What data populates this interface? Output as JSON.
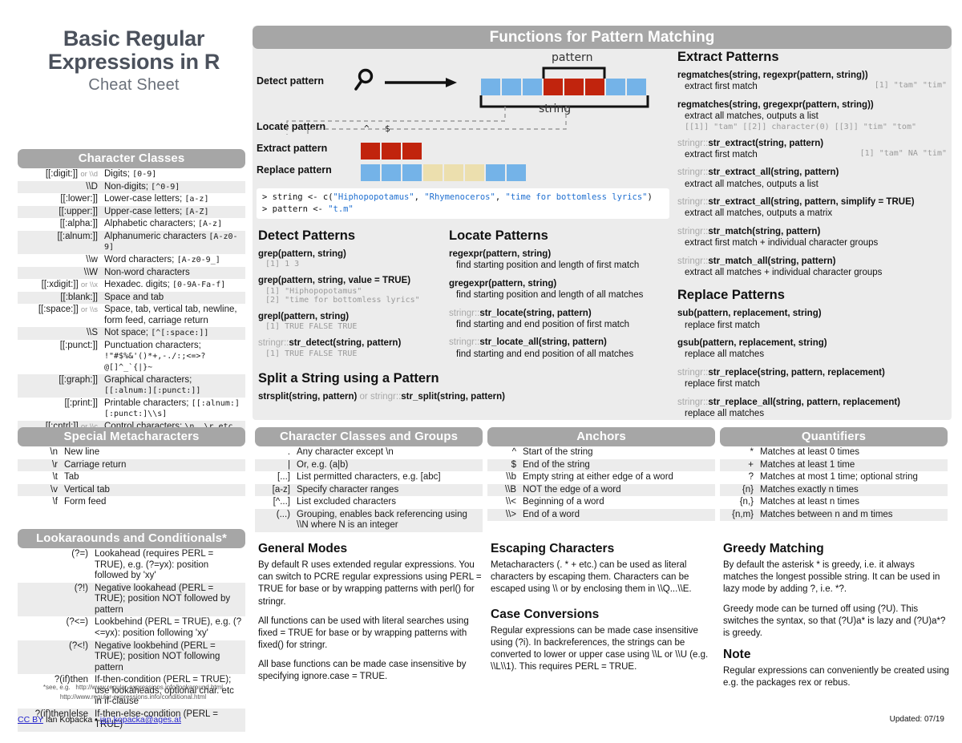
{
  "title": {
    "line1": "Basic Regular",
    "line2": "Expressions in R",
    "subtitle": "Cheat Sheet"
  },
  "main": {
    "header": "Functions for Pattern Matching"
  },
  "diagram": {
    "labels": {
      "detect": "Detect pattern",
      "locate": "Locate pattern",
      "extract": "Extract pattern",
      "replace": "Replace pattern"
    },
    "annotations": {
      "pattern": "pattern",
      "string": "string"
    },
    "locate_marks": {
      "start": "^",
      "end": "$"
    },
    "colors": {
      "blue": "#74b3e8",
      "red": "#c1240d",
      "tan": "#ecdfae"
    }
  },
  "console": {
    "line1_prompt": "> ",
    "line1_a": "string <- c(",
    "line1_s1": "\"Hiphopopotamus\"",
    "line1_c1": ", ",
    "line1_s2": "\"Rhymenoceros\"",
    "line1_c2": ", ",
    "line1_s3": "\"time for bottomless lyrics\"",
    "line1_end": ")",
    "line2_prompt": "> ",
    "line2_a": "pattern <- ",
    "line2_s1": "\"t.m\""
  },
  "character_classes": {
    "header": "Character Classes",
    "rows": [
      {
        "key": "[[:digit:]]",
        "key_alt": "or \\\\d",
        "desc": "Digits;",
        "code": "[0-9]"
      },
      {
        "key": "\\\\D",
        "key_alt": "",
        "desc": "Non-digits;",
        "code": "[^0-9]"
      },
      {
        "key": "[[:lower:]]",
        "key_alt": "",
        "desc": "Lower-case letters;",
        "code": "[a-z]"
      },
      {
        "key": "[[:upper:]]",
        "key_alt": "",
        "desc": "Upper-case letters;",
        "code": "[A-Z]"
      },
      {
        "key": "[[:alpha:]]",
        "key_alt": "",
        "desc": "Alphabetic characters;",
        "code": "[A-z]"
      },
      {
        "key": "[[:alnum:]]",
        "key_alt": "",
        "desc": "Alphanumeric characters",
        "code": "[A-z0-9]"
      },
      {
        "key": "\\\\w",
        "key_alt": "",
        "desc": "Word characters;",
        "code": "[A-z0-9_]"
      },
      {
        "key": "\\\\W",
        "key_alt": "",
        "desc": "Non-word characters",
        "code": ""
      },
      {
        "key": "[[:xdigit:]]",
        "key_alt": "or \\\\x",
        "desc": "Hexadec. digits;",
        "code": "[0-9A-Fa-f]"
      },
      {
        "key": "[[:blank:]]",
        "key_alt": "",
        "desc": "Space and tab",
        "code": ""
      },
      {
        "key": "[[:space:]]",
        "key_alt": "or \\\\s",
        "desc": "Space, tab, vertical tab, newline, form feed, carriage return",
        "code": ""
      },
      {
        "key": "\\\\S",
        "key_alt": "",
        "desc": "Not space;",
        "code": "[^[:space:]]"
      },
      {
        "key": "[[:punct:]]",
        "key_alt": "",
        "desc": "Punctuation characters;",
        "code": "!\"#$%&'()*+,-./:;<=>?@[]^_`{|}~"
      },
      {
        "key": "[[:graph:]]",
        "key_alt": "",
        "desc": "Graphical characters;",
        "code": "[[:alnum:][:punct:]]"
      },
      {
        "key": "[[:print:]]",
        "key_alt": "",
        "desc": "Printable characters;",
        "code": "[[:alnum:][:punct:]\\\\s]"
      },
      {
        "key": "[[:cntrl:]]",
        "key_alt": "or \\\\c",
        "desc": "Control characters;",
        "code": "\\n,  \\r etc."
      }
    ]
  },
  "special_metacharacters": {
    "header": "Special Metacharacters",
    "rows": [
      {
        "key": "\\n",
        "desc": "New line"
      },
      {
        "key": "\\r",
        "desc": "Carriage return"
      },
      {
        "key": "\\t",
        "desc": "Tab"
      },
      {
        "key": "\\v",
        "desc": "Vertical tab"
      },
      {
        "key": "\\f",
        "desc": "Form feed"
      }
    ]
  },
  "lookarounds": {
    "header": "Lookaraounds and Conditionals*",
    "rows": [
      {
        "key": "(?=)",
        "key_grey": "",
        "desc": "Lookahead (requires PERL = TRUE), e.g. (?=yx): position followed by 'xy'"
      },
      {
        "key": "(?!)",
        "key_grey": "",
        "desc": "Negative lookahead (PERL = TRUE); position NOT followed by pattern"
      },
      {
        "key": "(?<=)",
        "key_grey": "",
        "desc": "Lookbehind (PERL = TRUE), e.g. (?<=yx): position following 'xy'"
      },
      {
        "key": "(?<!)",
        "key_grey": "",
        "desc": "Negative lookbehind (PERL = TRUE); position NOT following pattern"
      },
      {
        "key": "?(if)then",
        "key_grey": "",
        "desc": "If-then-condition (PERL = TRUE); use lookaheads, optional char. etc in if-clause"
      },
      {
        "key": "?(if)then|else",
        "key_grey": "",
        "desc": "If-then-else-condition (PERL = TRUE)"
      }
    ],
    "footnote_label": "*see, e.g.",
    "footnote_url1": "http://www.regular-expressions.info/lookaround.html",
    "footnote_url2": "http://www.regular-expressions.info/conditional.html"
  },
  "detect_patterns": {
    "header": "Detect Patterns",
    "items": [
      {
        "sig": "grep(pattern, string)",
        "pkg": "",
        "desc": "",
        "out": "[1] 1 3"
      },
      {
        "sig": "grep(pattern, string, value = TRUE)",
        "pkg": "",
        "desc": "",
        "out": "[1] \"Hiphopopotamus\"\n[2] \"time for bottomless lyrics\""
      },
      {
        "sig": "grepl(pattern, string)",
        "pkg": "",
        "desc": "",
        "out": "[1]  TRUE FALSE  TRUE"
      },
      {
        "sig": "str_detect(string, pattern)",
        "pkg": "stringr::",
        "desc": "",
        "out": "[1]  TRUE FALSE  TRUE"
      }
    ]
  },
  "split_string": {
    "header": "Split a String using a Pattern",
    "sig_a": "strsplit(string, pattern)",
    "sig_or": " or ",
    "sig_pkg": "stringr::",
    "sig_b": "str_split(string, pattern)"
  },
  "locate_patterns": {
    "header": "Locate Patterns",
    "items": [
      {
        "pkg": "",
        "sig": "regexpr(pattern, string)",
        "desc": "find starting position and length of first match"
      },
      {
        "pkg": "",
        "sig": "gregexpr(pattern, string)",
        "desc": "find starting position and length of all matches"
      },
      {
        "pkg": "stringr::",
        "sig": "str_locate(string, pattern)",
        "desc": "find starting and end position of first match"
      },
      {
        "pkg": "stringr::",
        "sig": "str_locate_all(string, pattern)",
        "desc": "find starting and end position of all matches"
      }
    ]
  },
  "extract_patterns": {
    "header": "Extract Patterns",
    "items": [
      {
        "pkg": "",
        "sig": "regmatches(string, regexpr(pattern, string))",
        "desc": "extract first match",
        "out": "[1] \"tam\" \"tim\"",
        "inline": true
      },
      {
        "pkg": "",
        "sig": "regmatches(string, gregexpr(pattern, string))",
        "desc": "extract all matches, outputs a list",
        "out": "[[1]] \"tam\" [[2]] character(0) [[3]] \"tim\" \"tom\"",
        "inline": false
      },
      {
        "pkg": "stringr::",
        "sig": "str_extract(string, pattern)",
        "desc": "extract first match",
        "out": "[1] \"tam\" NA  \"tim\"",
        "inline": true
      },
      {
        "pkg": "stringr::",
        "sig": "str_extract_all(string, pattern)",
        "desc": "extract all matches, outputs a list",
        "out": "",
        "inline": false
      },
      {
        "pkg": "stringr::",
        "sig": "str_extract_all(string, pattern, simplify = TRUE)",
        "desc": "extract all matches, outputs a matrix",
        "out": "",
        "inline": false
      },
      {
        "pkg": "stringr::",
        "sig": "str_match(string, pattern)",
        "desc": "extract first match + individual character groups",
        "out": "",
        "inline": false
      },
      {
        "pkg": "stringr::",
        "sig": "str_match_all(string, pattern)",
        "desc": "extract all matches + individual character groups",
        "out": "",
        "inline": false
      }
    ]
  },
  "replace_patterns": {
    "header": "Replace Patterns",
    "items": [
      {
        "pkg": "",
        "sig": "sub(pattern, replacement, string)",
        "desc": "replace first match"
      },
      {
        "pkg": "",
        "sig": "gsub(pattern, replacement, string)",
        "desc": "replace all matches"
      },
      {
        "pkg": "stringr::",
        "sig": "str_replace(string, pattern, replacement)",
        "desc": "replace first match"
      },
      {
        "pkg": "stringr::",
        "sig": "str_replace_all(string, pattern, replacement)",
        "desc": "replace all matches"
      }
    ]
  },
  "classes_and_groups": {
    "header": "Character Classes and Groups",
    "rows": [
      {
        "key": ".",
        "key_dim": "",
        "desc": "Any character except \\n"
      },
      {
        "key": "|",
        "key_dim": "",
        "desc": "Or, e.g. (a|b)"
      },
      {
        "key": "[...]",
        "key_dim": "",
        "desc": "List permitted characters, e.g. [abc]"
      },
      {
        "key": "[a-z]",
        "key_dim": "",
        "desc": "Specify character ranges"
      },
      {
        "key": "[^...]",
        "key_dim": "",
        "desc": "List excluded characters"
      },
      {
        "key": "(...)",
        "key_dim": "",
        "desc": "Grouping, enables back referencing using \\\\N where N is an integer"
      }
    ]
  },
  "anchors": {
    "header": "Anchors",
    "rows": [
      {
        "key": "^",
        "desc": "Start of the string"
      },
      {
        "key": "$",
        "desc": "End of the string"
      },
      {
        "key": "\\\\b",
        "desc": "Empty string at either edge of a word"
      },
      {
        "key": "\\\\B",
        "desc": "NOT the edge of a word"
      },
      {
        "key": "\\\\<",
        "desc": "Beginning of a word"
      },
      {
        "key": "\\\\>",
        "desc": "End of a word"
      }
    ]
  },
  "quantifiers": {
    "header": "Quantifiers",
    "rows": [
      {
        "key": "*",
        "desc": "Matches at least 0 times"
      },
      {
        "key": "+",
        "desc": "Matches at least 1 time"
      },
      {
        "key": "?",
        "desc": "Matches at most 1 time; optional string"
      },
      {
        "key": "{n}",
        "desc": "Matches exactly n times"
      },
      {
        "key": "{n,}",
        "desc": "Matches at least n times"
      },
      {
        "key": "{n,m}",
        "desc": "Matches between n and m times"
      }
    ]
  },
  "general_modes": {
    "header": "General Modes",
    "p1": "By default R uses extended regular expressions. You can switch to PCRE regular expressions using PERL = TRUE for base or by wrapping patterns with perl() for stringr.",
    "p2": "All functions can be used with literal searches using fixed = TRUE for base or by wrapping patterns with fixed() for stringr.",
    "p3": "All base functions can be made case insensitive by specifying ignore.case = TRUE."
  },
  "escaping": {
    "header": "Escaping Characters",
    "p1": "Metacharacters (. * + etc.) can be used as literal characters by escaping them. Characters can be escaped using \\\\ or by enclosing them in \\\\Q...\\\\E."
  },
  "case_conversions": {
    "header": "Case Conversions",
    "p1": "Regular expressions can be made case insensitive using (?i). In backreferences, the strings can be converted to lower or upper case using \\\\L or \\\\U (e.g. \\\\L\\\\1). This requires PERL = TRUE."
  },
  "greedy": {
    "header": "Greedy Matching",
    "p1": "By default the asterisk * is greedy, i.e. it always matches the longest possible string. It can be used in lazy mode by adding ?, i.e. *?.",
    "p2": "Greedy mode can be turned off using (?U). This switches the syntax, so that (?U)a* is lazy and (?U)a*? is greedy."
  },
  "note": {
    "header": "Note",
    "p1": "Regular expressions can conveniently be created using e.g. the packages rex or rebus."
  },
  "footer": {
    "license": "CC BY",
    "author": " Ian Kopacka  •  ",
    "email": "ian.kopacka@ages.at",
    "updated": "Updated: 07/19"
  }
}
